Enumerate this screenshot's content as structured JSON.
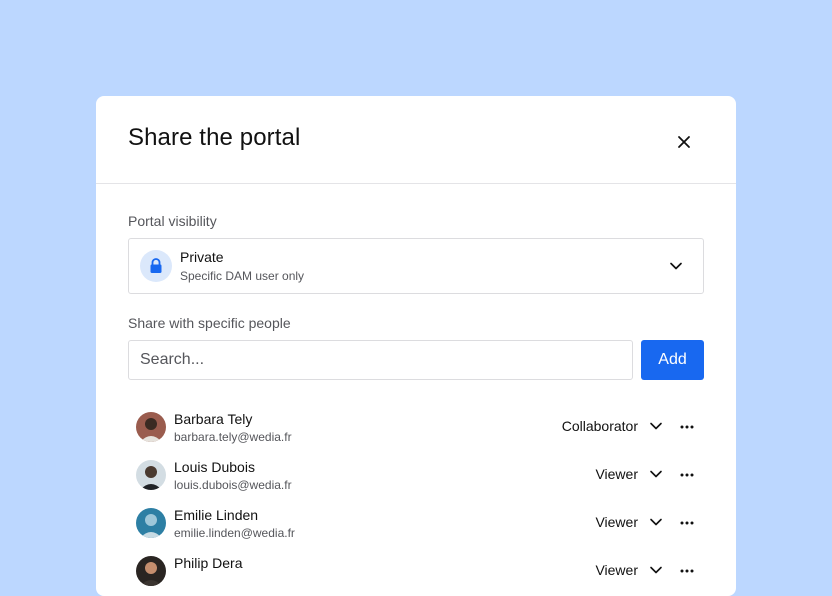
{
  "modal": {
    "title": "Share the portal",
    "close_icon": "close-icon"
  },
  "visibility": {
    "label": "Portal visibility",
    "selected_title": "Private",
    "selected_subtitle": "Specific DAM user only",
    "icon": "lock-icon"
  },
  "share": {
    "label": "Share with specific people",
    "search_placeholder": "Search...",
    "search_value": "",
    "add_label": "Add"
  },
  "people": [
    {
      "name": "Barbara Tely",
      "email": "barbara.tely@wedia.fr",
      "role": "Collaborator"
    },
    {
      "name": "Louis Dubois",
      "email": "louis.dubois@wedia.fr",
      "role": "Viewer"
    },
    {
      "name": "Emilie Linden",
      "email": "emilie.linden@wedia.fr",
      "role": "Viewer"
    },
    {
      "name": "Philip Dera",
      "email": "",
      "role": "Viewer"
    }
  ],
  "colors": {
    "background": "#bcd7ff",
    "accent": "#1868f0",
    "lock_badge_bg": "#dbe8fb"
  }
}
